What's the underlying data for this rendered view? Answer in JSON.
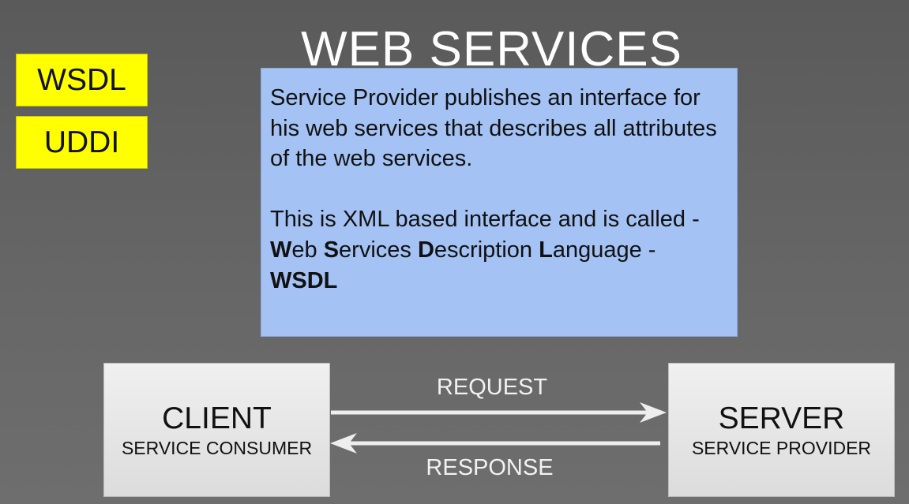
{
  "title": "WEB SERVICES",
  "sidebar": {
    "buttons": [
      {
        "label": "WSDL"
      },
      {
        "label": "UDDI"
      }
    ]
  },
  "info_box": {
    "para1": "Service Provider publishes an interface for his web services that describes all attributes of the web services.",
    "para2": "This is XML based interface and is called -",
    "acronym_words": [
      {
        "initial": "W",
        "rest": "eb"
      },
      {
        "initial": "S",
        "rest": "ervices"
      },
      {
        "initial": "D",
        "rest": "escription"
      },
      {
        "initial": "L",
        "rest": "anguage"
      }
    ],
    "acronym_suffix": " -",
    "acronym": "WSDL"
  },
  "client": {
    "title": "CLIENT",
    "subtitle": "SERVICE CONSUMER"
  },
  "server": {
    "title": "SERVER",
    "subtitle": "SERVICE PROVIDER"
  },
  "flow": {
    "request_label": "REQUEST",
    "response_label": "RESPONSE"
  },
  "colors": {
    "background": "#636363",
    "yellow": "#ffff00",
    "info_box": "#a4c2f4",
    "node": "#e6e6e6",
    "arrow": "#eeeeee"
  }
}
